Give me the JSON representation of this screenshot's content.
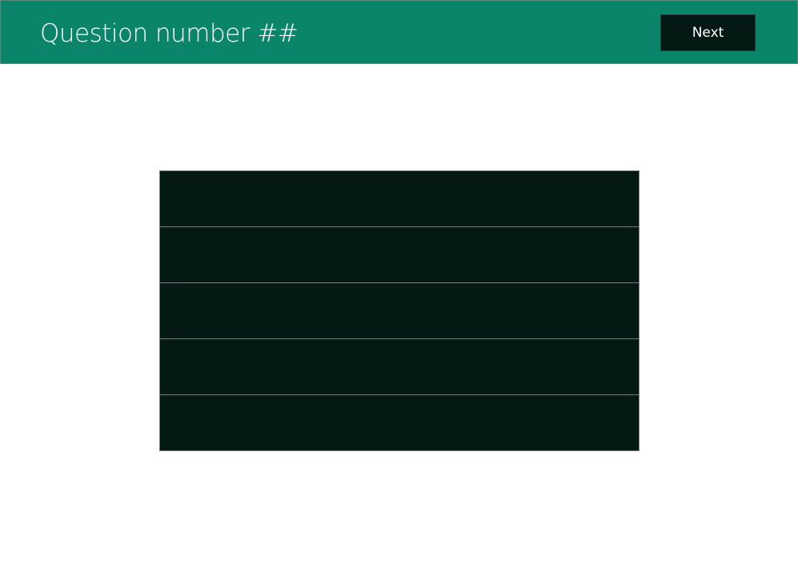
{
  "header": {
    "title": "Question number ##",
    "next_label": "Next"
  },
  "answers": [
    {
      "label": ""
    },
    {
      "label": ""
    },
    {
      "label": ""
    },
    {
      "label": ""
    },
    {
      "label": ""
    }
  ],
  "colors": {
    "header_bg": "#0a8569",
    "button_bg": "#041913",
    "answer_bg": "#041913",
    "divider": "#7a7f7d"
  }
}
